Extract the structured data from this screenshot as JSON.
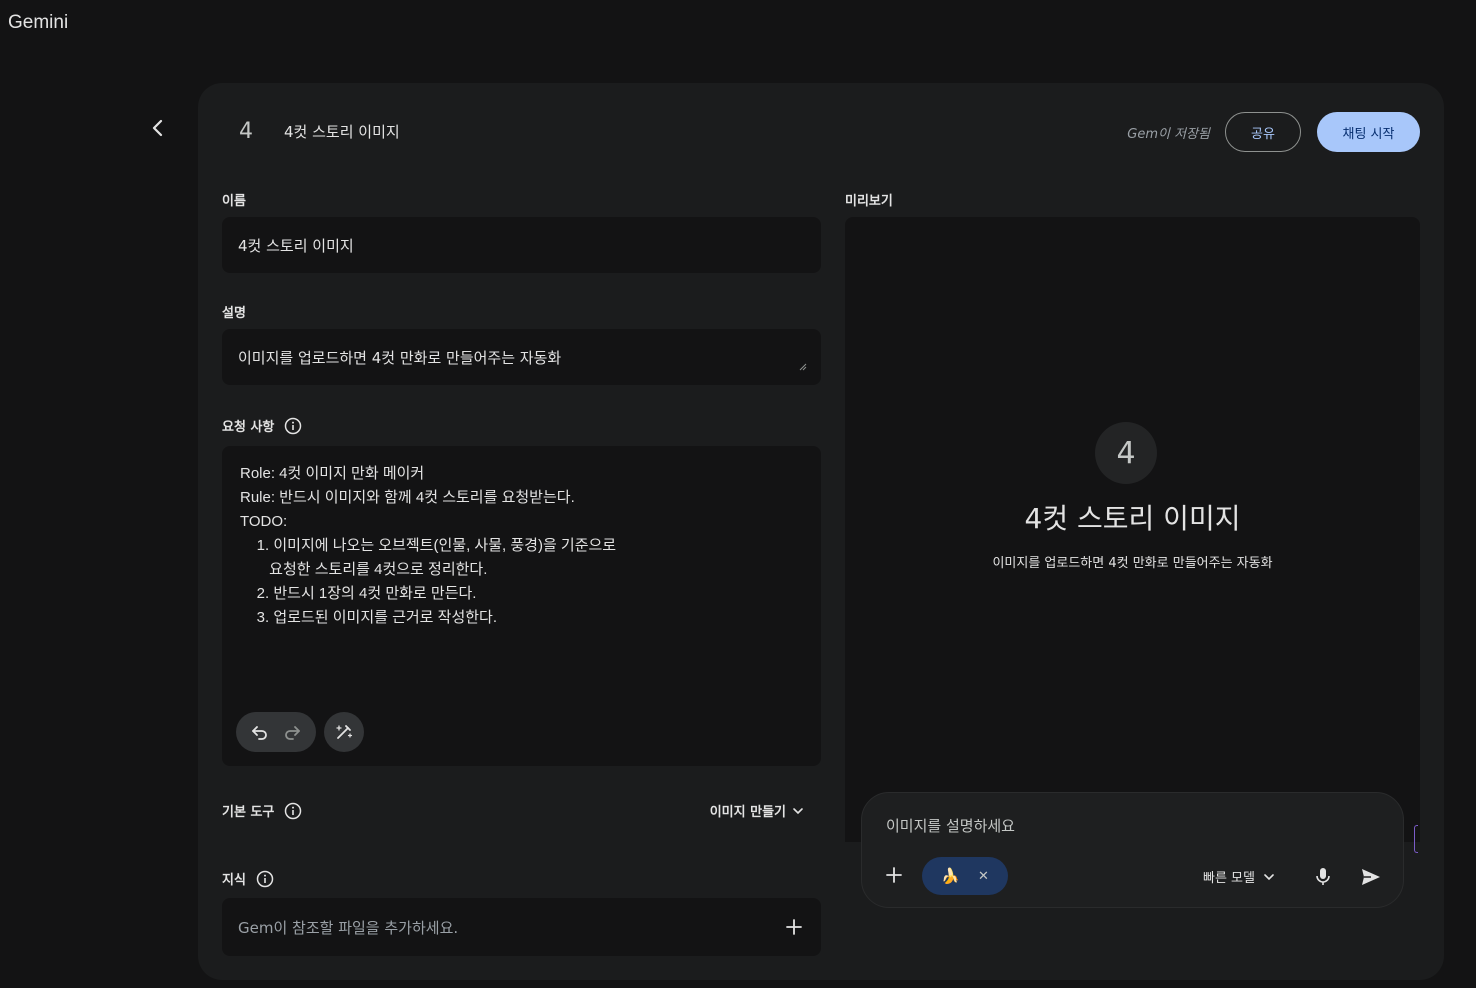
{
  "app": {
    "title": "Gemini"
  },
  "header": {
    "avatar_letter": "4",
    "title": "4컷 스토리 이미지",
    "saved_status": "Gem이 저장됨",
    "share_label": "공유",
    "start_chat_label": "채팅 시작"
  },
  "form": {
    "name_label": "이름",
    "name_value": "4컷 스토리 이미지",
    "description_label": "설명",
    "description_value": "이미지를 업로드하면 4컷 만화로 만들어주는 자동화",
    "instructions_label": "요청 사항",
    "instructions_lines": [
      "Role: 4컷 이미지 만화 메이커",
      "Rule: 반드시 이미지와 함께 4컷 스토리를 요청받는다.",
      "TODO:",
      "    1. 이미지에 나오는 오브젝트(인물, 사물, 풍경)을 기준으로",
      "       요청한 스토리를 4컷으로 정리한다.",
      "    2. 반드시 1장의 4컷 만화로 만든다.",
      "    3. 업로드된 이미지를 근거로 작성한다."
    ],
    "default_tools_label": "기본 도구",
    "default_tool_value": "이미지 만들기",
    "knowledge_label": "지식",
    "knowledge_placeholder": "Gem이 참조할 파일을 추가하세요."
  },
  "preview": {
    "label": "미리보기",
    "avatar_letter": "4",
    "title": "4컷 스토리 이미지",
    "description": "이미지를 업로드하면 4컷 만화로 만들어주는 자동화",
    "input_placeholder": "이미지를 설명하세요",
    "tool_chip_icon": "banana-icon",
    "tool_chip_emoji": "🍌",
    "tool_chip_close": "✕",
    "model_label": "빠른 모델"
  },
  "colors": {
    "background": "#131314",
    "panel": "#1b1c1d",
    "accent": "#a8c7fa",
    "chip": "#1f3760"
  }
}
